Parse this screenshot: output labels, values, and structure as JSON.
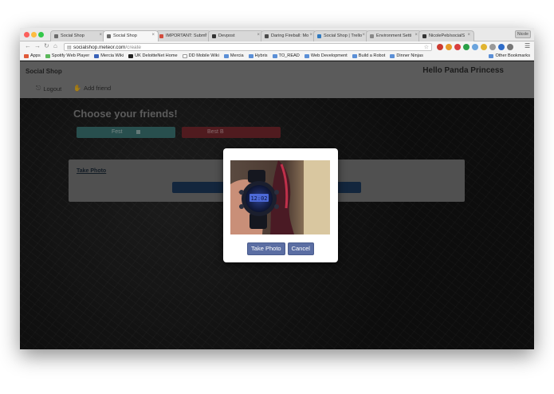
{
  "browser": {
    "tabs": [
      {
        "label": "Social Shop",
        "favicon_color": "#6b6b6b",
        "active": false
      },
      {
        "label": "Social Shop",
        "favicon_color": "#6b6b6b",
        "active": true
      },
      {
        "label": "IMPORTANT: Submi",
        "favicon_color": "#d24b3c",
        "active": false
      },
      {
        "label": "Devpost",
        "favicon_color": "#333333",
        "active": false
      },
      {
        "label": "Daring Fireball: Mo",
        "favicon_color": "#4a4a4a",
        "active": false
      },
      {
        "label": "Social Shop | Trello",
        "favicon_color": "#2f79bf",
        "active": false
      },
      {
        "label": "Environment Setti",
        "favicon_color": "#888888",
        "active": false
      },
      {
        "label": "NicolePeb/socialS",
        "favicon_color": "#333333",
        "active": false
      }
    ],
    "user_button": "Nicole",
    "url_host": "socialshop.meteor.com",
    "url_path": "/create",
    "bookmarks": [
      {
        "label": "Apps",
        "icon_color": "#e05a3a"
      },
      {
        "label": "Spotify Web Player",
        "icon_color": "#5cb85c"
      },
      {
        "label": "Mercia Wiki",
        "icon_color": "#3a62b8"
      },
      {
        "label": "UK DeloitteNet Home",
        "icon_color": "#222222"
      },
      {
        "label": "DD Mobile Wiki",
        "icon_color": "#ffffff"
      },
      {
        "label": "Mercia",
        "icon_color": "#5b8fd6"
      },
      {
        "label": "Hybris",
        "icon_color": "#5b8fd6"
      },
      {
        "label": "TO_READ",
        "icon_color": "#5b8fd6"
      },
      {
        "label": "Web Development",
        "icon_color": "#5b8fd6"
      },
      {
        "label": "Build a Robot",
        "icon_color": "#5b8fd6"
      },
      {
        "label": "Dinner Ninjas",
        "icon_color": "#5b8fd6"
      }
    ],
    "other_bookmarks": "Other Bookmarks"
  },
  "app": {
    "brand": "Social Shop",
    "greeting": "Hello Panda Princess",
    "nav": {
      "logout": "Logout",
      "add_friend": "Add friend"
    },
    "heading": "Choose your friends!",
    "friend_buttons": {
      "fest": "Fest",
      "best": "Best B"
    },
    "take_photo_link": "Take Photo"
  },
  "modal": {
    "take_photo_button": "Take Photo",
    "cancel_button": "Cancel"
  },
  "colors": {
    "header_bg": "#8d8d8d",
    "fest_button": "#3e7a78",
    "best_button": "#7c2a30",
    "submit_button": "#1e3b5f",
    "modal_button": "#5b6ea3"
  }
}
